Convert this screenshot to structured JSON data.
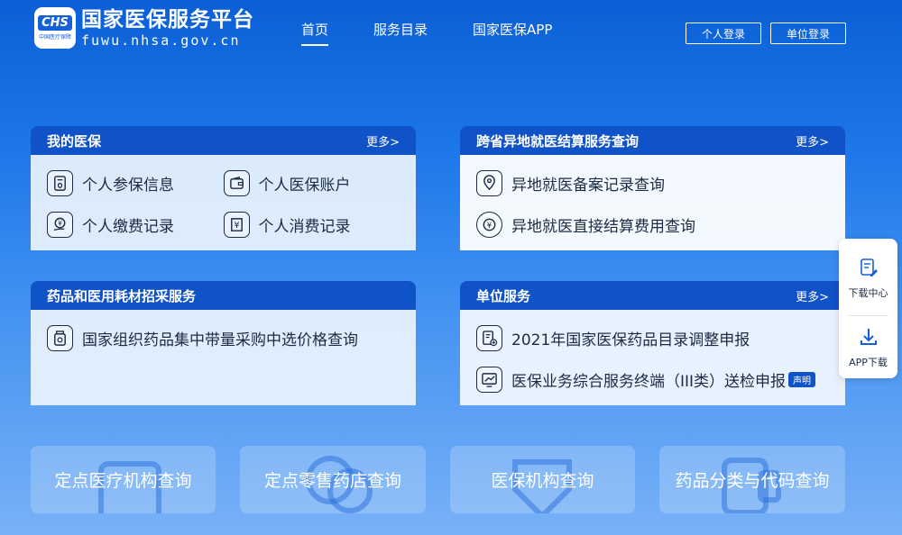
{
  "header": {
    "logo_badge": "CHS",
    "logo_badge_sub": "中国医疗保障",
    "site_title": "国家医保服务平台",
    "site_url": "fuwu.nhsa.gov.cn",
    "nav": [
      {
        "label": "首页",
        "active": true
      },
      {
        "label": "服务目录",
        "active": false
      },
      {
        "label": "国家医保APP",
        "active": false
      }
    ],
    "personal_login": "个人登录",
    "unit_login": "单位登录"
  },
  "panels": {
    "my_insurance": {
      "title": "我的医保",
      "more": "更多>",
      "items": [
        "个人参保信息",
        "个人医保账户",
        "个人缴费记录",
        "个人消费记录"
      ]
    },
    "cross_province": {
      "title": "跨省异地就医结算服务查询",
      "more": "更多>",
      "items": [
        "异地就医备案记录查询",
        "异地就医直接结算费用查询"
      ]
    },
    "drug_procurement": {
      "title": "药品和医用耗材招采服务",
      "items": [
        "国家组织药品集中带量采购中选价格查询"
      ]
    },
    "unit_service": {
      "title": "单位服务",
      "more": "更多>",
      "items": [
        "2021年国家医保药品目录调整申报",
        "医保业务综合服务终端（III类）送检申报"
      ],
      "notice_tag": "声明"
    }
  },
  "side": {
    "download_center": "下载中心",
    "app_download": "APP下载"
  },
  "cards": [
    "定点医疗机构查询",
    "定点零售药店查询",
    "医保机构查询",
    "药品分类与代码查询"
  ],
  "colors": {
    "header_blue": "#1052c7",
    "panel_body": "#ebf3fd"
  }
}
